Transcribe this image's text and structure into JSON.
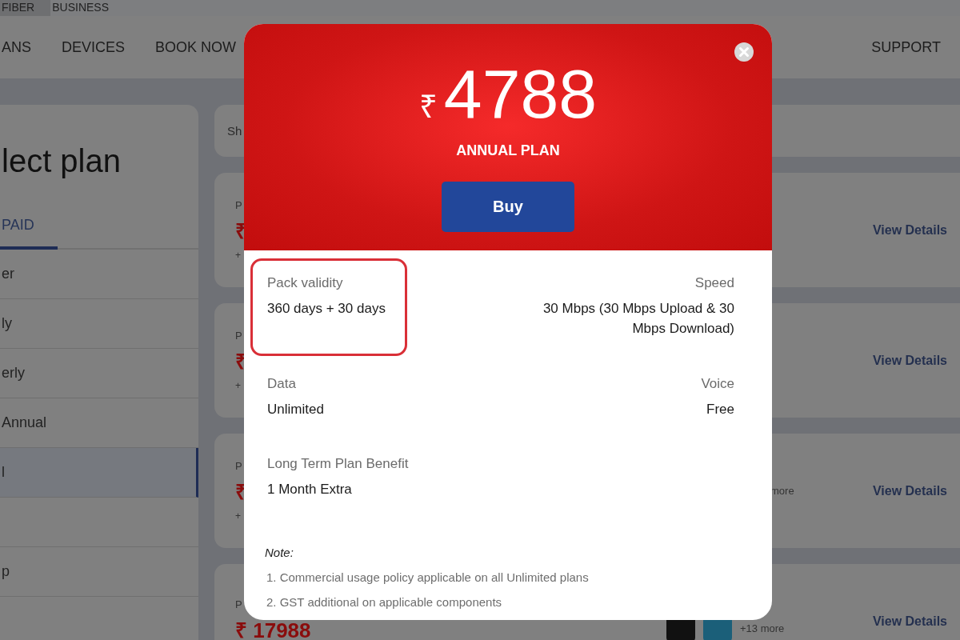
{
  "top_tabs": [
    {
      "label": "FIBER",
      "selected": true
    },
    {
      "label": "BUSINESS",
      "selected": false
    }
  ],
  "nav": {
    "items": [
      "ANS",
      "DEVICES",
      "BOOK NOW"
    ],
    "support": "SUPPORT"
  },
  "sidebar": {
    "title": "lect plan",
    "tabs": [
      {
        "label": "PAID",
        "selected": true
      }
    ],
    "items": [
      {
        "label": "er",
        "selected": false
      },
      {
        "label": "ly",
        "selected": false
      },
      {
        "label": "erly",
        "selected": false
      },
      {
        "label": "Annual",
        "selected": false
      },
      {
        "label": "l",
        "selected": true
      },
      {
        "selected": false
      },
      {
        "label": "p",
        "selected": false
      }
    ]
  },
  "search": {
    "placeholder": "Sh"
  },
  "plans": [
    {
      "kind": "basic",
      "label": "P",
      "price": "₹",
      "extra": "+",
      "link": "View Details"
    },
    {
      "kind": "basic",
      "label": "P",
      "price": "₹",
      "extra": "+",
      "link": "View Details"
    },
    {
      "kind": "more",
      "label": "P",
      "price": "₹",
      "extra": "+",
      "more": "more",
      "link": "View Details"
    },
    {
      "kind": "apps",
      "label": "P",
      "price": "₹ 17988",
      "more": "+13 more",
      "link": "View Details"
    }
  ],
  "modal": {
    "currency": "₹",
    "price": "4788",
    "plan": "ANNUAL PLAN",
    "buy": "Buy",
    "details": [
      {
        "label": "Pack validity",
        "value": "360 days + 30 days",
        "highlighted": true
      },
      {
        "label": "Speed",
        "value": "30 Mbps (30 Mbps Upload & 30 Mbps Download)",
        "highlighted": false
      },
      {
        "label": "Data",
        "value": "Unlimited",
        "highlighted": false
      },
      {
        "label": "Voice",
        "value": "Free",
        "highlighted": false
      },
      {
        "label": "Long Term Plan Benefit",
        "value": "1 Month Extra",
        "highlighted": false
      }
    ],
    "note": {
      "title": "Note:",
      "items": [
        "1. Commercial usage policy applicable on all Unlimited plans",
        "2. GST additional on applicable components"
      ]
    }
  }
}
